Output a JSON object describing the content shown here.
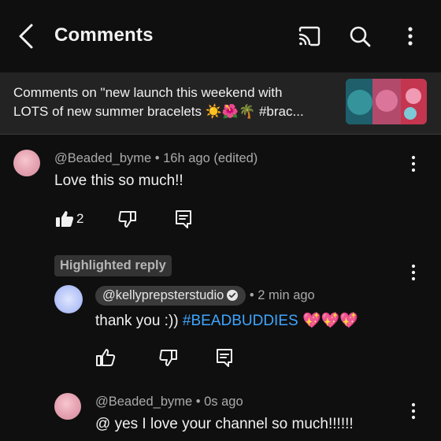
{
  "header": {
    "title": "Comments",
    "icons": [
      "back-arrow-icon",
      "cast-icon",
      "search-icon",
      "more-vertical-icon"
    ]
  },
  "video": {
    "line1": "Comments on \"new launch this weekend with",
    "line2": "LOTS of new summer bracelets ☀️🌺🌴 #brac..."
  },
  "comments": [
    {
      "handle": "@Beaded_byme",
      "meta": " • 16h ago (edited)",
      "text": "Love this so much!!",
      "likes": "2"
    }
  ],
  "highlighted": {
    "badge": "Highlighted reply",
    "handle": "@kellyprepsterstudio",
    "meta": " • 2 min ago",
    "text_prefix": "thank you :)) ",
    "hashtag": "#BEADBUDDIES",
    "text_suffix": " 💖💖💖"
  },
  "reply2": {
    "handle": "@Beaded_byme",
    "meta": " • 0s ago",
    "text": "@ yes I love your channel so much!!!!!!"
  },
  "colors": {
    "background": "#0f0f0f",
    "bar": "#232323",
    "link": "#3ea6ff",
    "muted": "#aaaaaa"
  }
}
